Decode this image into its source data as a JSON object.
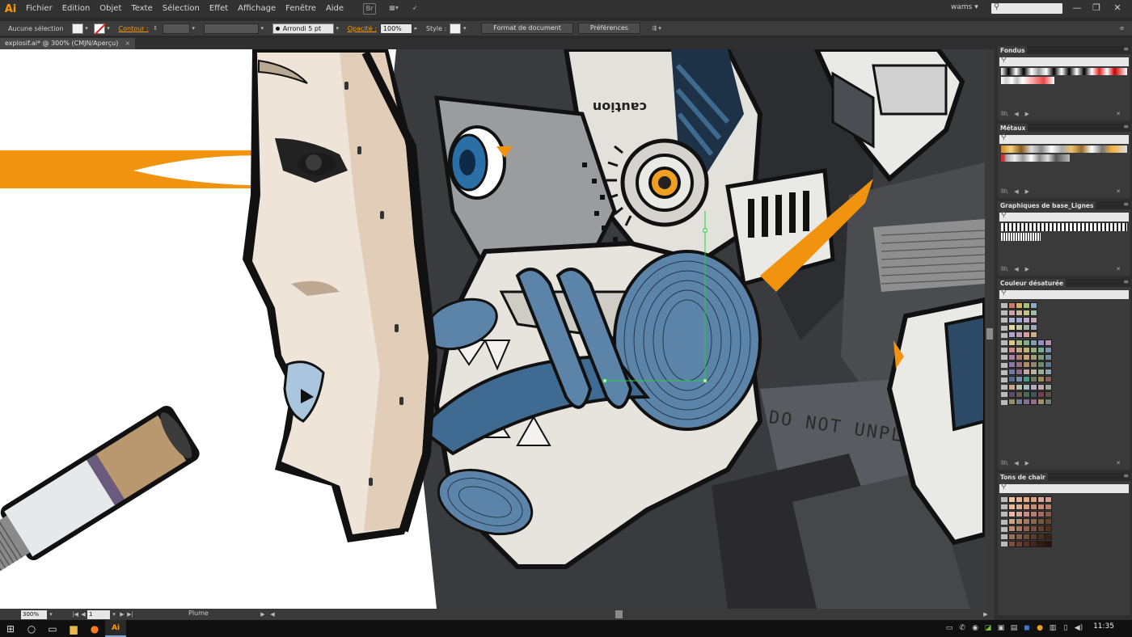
{
  "app": {
    "logo": "Ai",
    "workspace": "wams",
    "workspace_caret": "▾"
  },
  "menu": [
    "Fichier",
    "Edition",
    "Objet",
    "Texte",
    "Sélection",
    "Effet",
    "Affichage",
    "Fenêtre",
    "Aide"
  ],
  "window_buttons": {
    "minimize": "—",
    "maximize": "❐",
    "close": "✕"
  },
  "control": {
    "selection_label": "Aucune sélection",
    "contour_label": "Contour :",
    "stroke_style": "Arrondi 5 pt",
    "opacity_label": "Opacité :",
    "opacity_value": "100%",
    "style_label": "Style :",
    "doc_format_button": "Format de document",
    "prefs_button": "Préférences"
  },
  "document": {
    "tab_title": "explosif.ai* @ 300% (CMJN/Aperçu)",
    "tab_close": "×"
  },
  "status": {
    "zoom": "300%",
    "artboard": "1",
    "tool": "Plume"
  },
  "panels": [
    {
      "title": "Fondus"
    },
    {
      "title": "Métaux"
    },
    {
      "title": "Graphiques de base_Lignes"
    },
    {
      "title": "Couleur désaturée"
    },
    {
      "title": "Tons de chair"
    }
  ],
  "panel_icons": {
    "library": "lll\\",
    "prev": "◀",
    "next": "▶",
    "delete": "✕",
    "menu": "≡",
    "search": "⚲"
  },
  "artwork_text": {
    "caution": "caution",
    "do_not": "DO NOT UNPLUG"
  },
  "swatches": {
    "desaturated": [
      [
        "#c97a6a",
        "#d8b35e",
        "#a9c07f",
        "#8fa8c6"
      ],
      [
        "#c9a2a8",
        "#c8b89a",
        "#c3c08a",
        "#9fbf9f"
      ],
      [
        "#a8b7cf",
        "#9fa6cf",
        "#bda6cc",
        "#c5a6b3"
      ],
      [
        "#e3d8a8",
        "#c9c8a0",
        "#a3b1a0",
        "#9aa9b9"
      ],
      [
        "#b2a3c7",
        "#c19db2",
        "#d3a0a0",
        "#cfae88"
      ],
      [
        "#d6c68a",
        "#a8b97e",
        "#7fae8c",
        "#7d9fb6",
        "#9391bf",
        "#b98bb0"
      ],
      [
        "#c88a8a",
        "#c7a57e",
        "#bdb07a",
        "#92b07a",
        "#7aa99a",
        "#7a93b0"
      ],
      [
        "#a683a7",
        "#b7806e",
        "#c9a17a",
        "#a3a070",
        "#7e9a78",
        "#6f8ca0"
      ],
      [
        "#8a7aa3",
        "#9a6f7f",
        "#b0896f",
        "#8c8a6a",
        "#6f8a6c",
        "#5f7a90"
      ],
      [
        "#737a9c",
        "#8a6c88",
        "#c2a9a0",
        "#b7b09a",
        "#9aab98",
        "#8ea3b2"
      ],
      [
        "#5a6b8c",
        "#7d8fb0",
        "#4c9a86",
        "#6a7f55",
        "#9c8a5c",
        "#8a5c5c"
      ],
      [
        "#c9a890",
        "#b8c0a8",
        "#a8b8c0",
        "#b8a8c0",
        "#c0a8b0",
        "#9aa6a0"
      ],
      [
        "#5a4a6a",
        "#6a5a4a",
        "#4a6a5a",
        "#3f5560",
        "#704050",
        "#605040"
      ],
      [
        "#909070",
        "#708090",
        "#807090",
        "#907080",
        "#a09070",
        "#708070"
      ]
    ],
    "flesh": [
      [
        "#f0c6a6",
        "#e9b594",
        "#e5a987",
        "#e39e7c",
        "#d9a49b",
        "#d69a8e"
      ],
      [
        "#e7b89a",
        "#ddb08e",
        "#d49f7d",
        "#ca8e6e",
        "#c78a73",
        "#b97d66"
      ],
      [
        "#e8b6a6",
        "#d9a395",
        "#c98f82",
        "#b97c71",
        "#a86b62",
        "#8e5a4e"
      ],
      [
        "#c7a487",
        "#b28f73",
        "#9e7b61",
        "#8a6850",
        "#76563f",
        "#62462f"
      ],
      [
        "#b88a77",
        "#a57663",
        "#91624f",
        "#7c4f3d",
        "#693f2e",
        "#56301f"
      ],
      [
        "#96725c",
        "#835f4a",
        "#6f4d3a",
        "#5b3c2b",
        "#4a2e1f",
        "#3a2216"
      ],
      [
        "#7a5040",
        "#683f30",
        "#573124",
        "#472419",
        "#381910",
        "#2a1008"
      ]
    ]
  }
}
